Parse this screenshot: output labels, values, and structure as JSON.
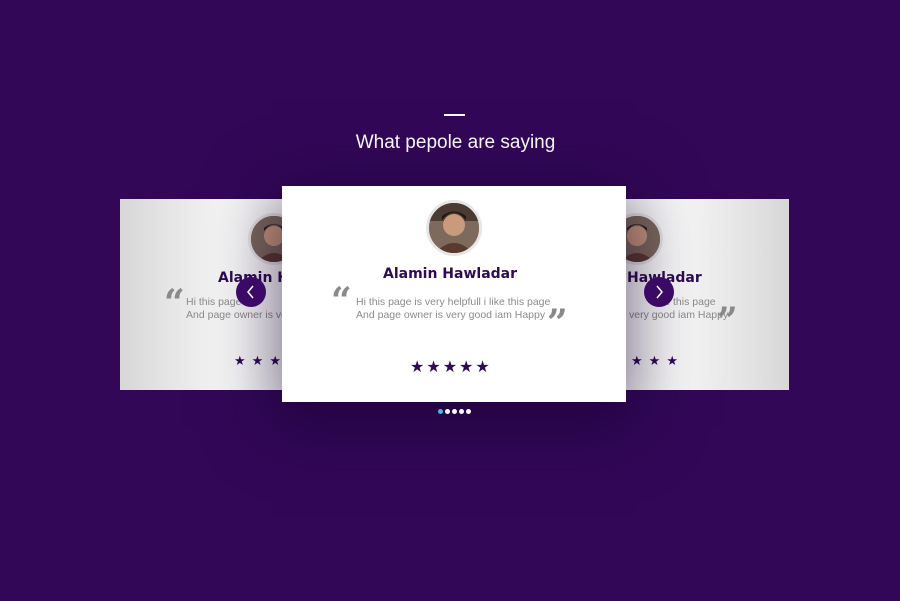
{
  "section": {
    "title": "What pepole are saying"
  },
  "testimonials": [
    {
      "name": "Alamin Hawladar",
      "line1": "Hi this page is very helpfull i like this page",
      "line2": "And page owner is very good iam Happy",
      "rating": 5
    }
  ],
  "side_left": {
    "name": "Alamin Haw",
    "line1": "Hi this page",
    "line2": "And page owner is ve",
    "stars": "★ ★ ★"
  },
  "side_right": {
    "name": "Hawladar",
    "line1": "ke this page",
    "line2": "very good iam Happy",
    "stars": "★ ★ ★"
  },
  "icons": {
    "prev": "chevron-left-icon",
    "next": "chevron-right-icon",
    "quote_open": "quote-open-icon",
    "quote_close": "quote-close-icon",
    "star": "star-icon"
  },
  "colors": {
    "background": "#320758",
    "accent": "#2f0a55",
    "active_dot": "#4fb3e6"
  },
  "pagination": {
    "count": 5,
    "active_index": 0
  }
}
